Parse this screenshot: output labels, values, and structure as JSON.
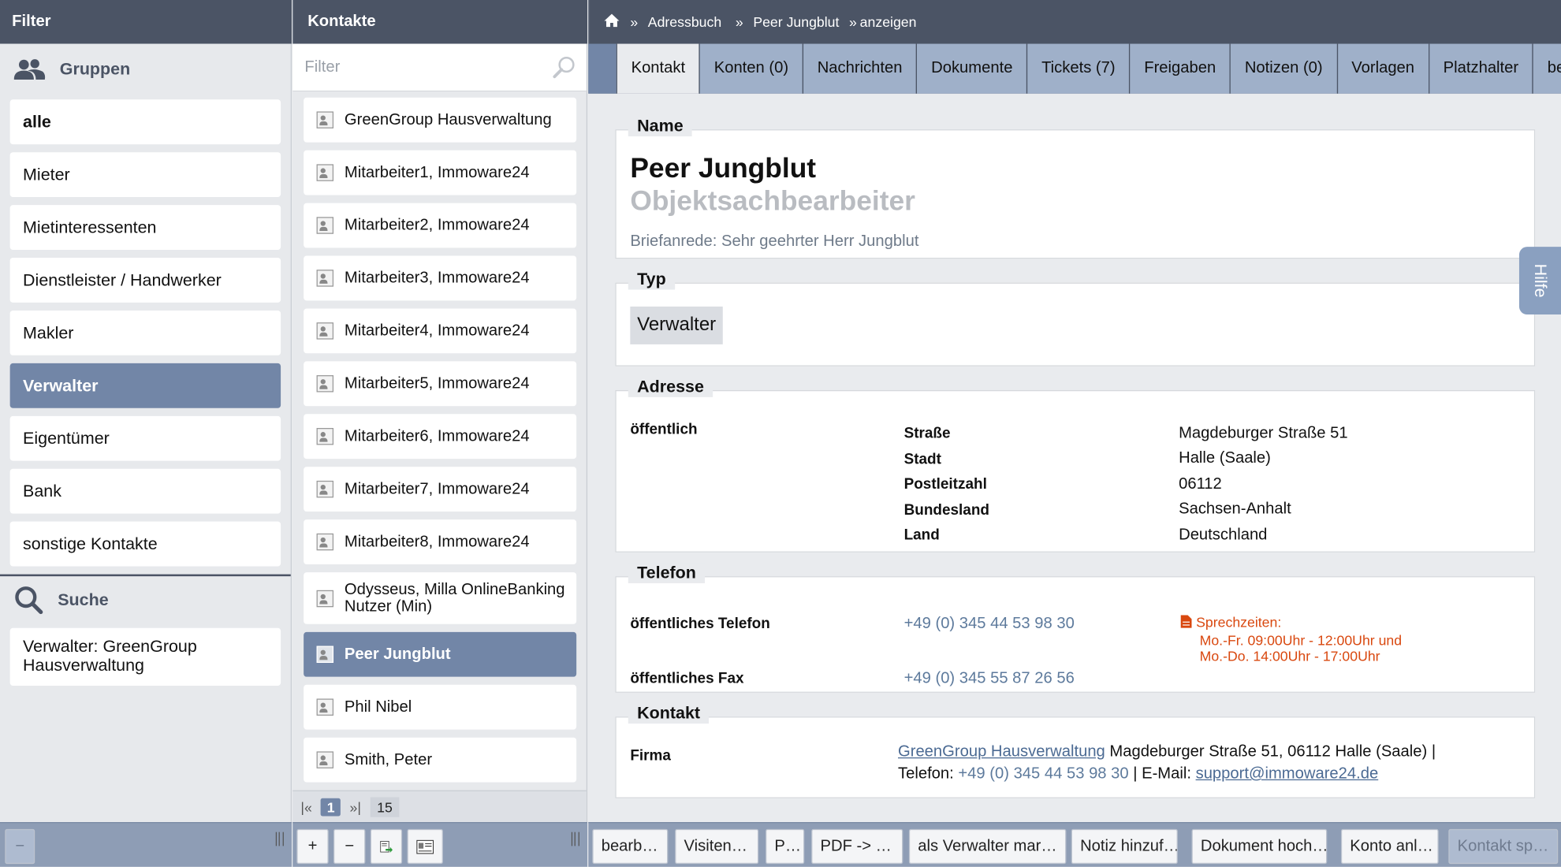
{
  "left": {
    "header": "Filter",
    "groups_title": "Gruppen",
    "groups": [
      "alle",
      "Mieter",
      "Mietinteressenten",
      "Dienstleister / Handwerker",
      "Makler",
      "Verwalter",
      "Eigentümer",
      "Bank",
      "sonstige Kontakte"
    ],
    "selected_group": "Verwalter",
    "search_title": "Suche",
    "search_item": "Verwalter: GreenGroup Hausverwaltung"
  },
  "middle": {
    "header": "Kontakte",
    "filter_placeholder": "Filter",
    "contacts": [
      "GreenGroup Hausverwaltung",
      "Mitarbeiter1, Immoware24",
      "Mitarbeiter2, Immoware24",
      "Mitarbeiter3, Immoware24",
      "Mitarbeiter4, Immoware24",
      "Mitarbeiter5, Immoware24",
      "Mitarbeiter6, Immoware24",
      "Mitarbeiter7, Immoware24",
      "Mitarbeiter8, Immoware24",
      "Odysseus, Milla OnlineBanking Nutzer (Min)",
      "Peer Jungblut",
      "Phil Nibel",
      "Smith, Peter"
    ],
    "selected_contact": "Peer Jungblut",
    "pager": {
      "first": "|«",
      "current": "1",
      "last": "»|",
      "total": "15"
    }
  },
  "breadcrumb": {
    "sep": "»",
    "items": [
      "Adressbuch",
      "Peer Jungblut",
      "anzeigen"
    ]
  },
  "tabs": [
    "Kontakt",
    "Konten (0)",
    "Nachrichten",
    "Dokumente",
    "Tickets (7)",
    "Freigaben",
    "Notizen (0)",
    "Vorlagen",
    "Platzhalter",
    "benu"
  ],
  "active_tab": "Kontakt",
  "detail": {
    "name_legend": "Name",
    "name": "Peer Jungblut",
    "position": "Objektsachbearbeiter",
    "salutation": "Briefanrede: Sehr geehrter Herr Jungblut",
    "typ_legend": "Typ",
    "typ": "Verwalter",
    "address_legend": "Adresse",
    "address_scope": "öffentlich",
    "address_rows": [
      {
        "label": "Straße",
        "value": "Magdeburger Straße 51"
      },
      {
        "label": "Stadt",
        "value": "Halle (Saale)"
      },
      {
        "label": "Postleitzahl",
        "value": "06112"
      },
      {
        "label": "Bundesland",
        "value": "Sachsen-Anhalt"
      },
      {
        "label": "Land",
        "value": "Deutschland"
      }
    ],
    "phone_legend": "Telefon",
    "phone_label": "öffentliches Telefon",
    "phone_value": "+49 (0) 345 44 53 98 30",
    "fax_label": "öffentliches Fax",
    "fax_value": "+49 (0) 345 55 87 26 56",
    "hours_title": "Sprechzeiten:",
    "hours_line1": "Mo.-Fr. 09:00Uhr - 12:00Uhr und",
    "hours_line2": "Mo.-Do. 14:00Uhr - 17:00Uhr",
    "kontakt_legend": "Kontakt",
    "firma_label": "Firma",
    "firma_link": "GreenGroup Hausverwaltung",
    "firma_address": " Magdeburger Straße 51, 06112 Halle (Saale) |",
    "firma_tel_label": "Telefon: ",
    "firma_tel": "+49 (0) 345 44 53 98 30",
    "firma_mail_label": " | E-Mail: ",
    "firma_mail": "support@immoware24.de"
  },
  "help_label": "Hilfe",
  "bottom": {
    "left_minus": "−",
    "mid_plus": "+",
    "mid_minus": "−",
    "actions": [
      "bearb…",
      "Visiten…",
      "P…",
      "PDF -> …",
      "als Verwalter mar…",
      "Notiz hinzuf…",
      "Dokument hoch…",
      "Konto anl…",
      "Kontakt sp…"
    ]
  },
  "colors": {
    "header": "#4b5465",
    "selected": "#7286a7",
    "tab": "#9fb0c9",
    "accent_orange": "#d9480f"
  }
}
